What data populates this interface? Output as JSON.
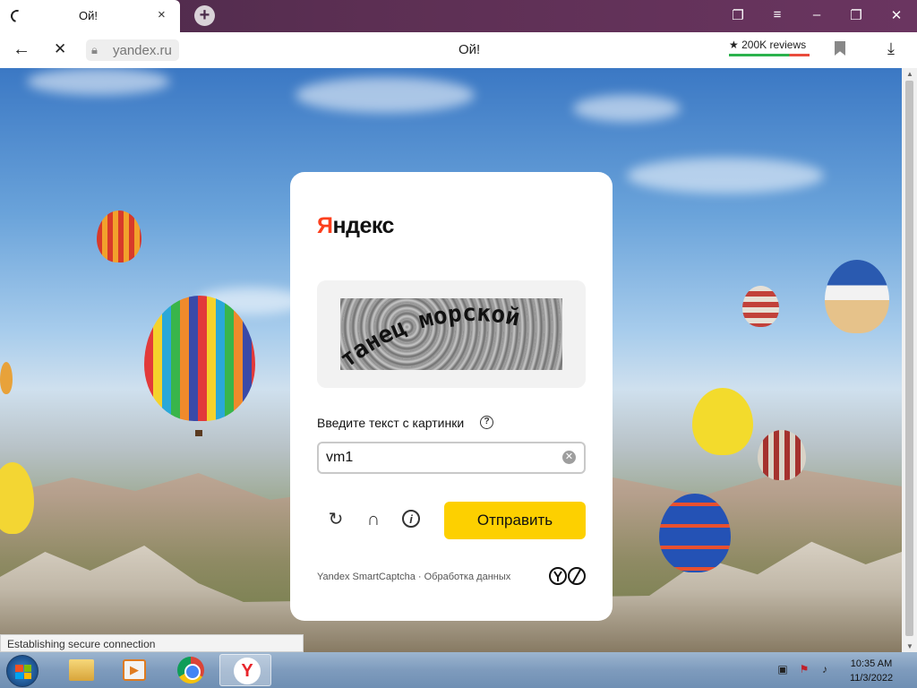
{
  "browser": {
    "tab_title": "Ой!",
    "tab_close": "×",
    "new_tab": "+",
    "url": "yandex.ru",
    "page_title": "Ой!",
    "reviews": "★ 200K reviews",
    "status_text": "Establishing secure connection"
  },
  "captcha": {
    "logo_first": "Я",
    "logo_rest": "ндекс",
    "captcha_words": "танец морской",
    "prompt_label": "Введите текст с картинки",
    "help_symbol": "?",
    "input_value": "vm1",
    "submit_label": "Отправить",
    "footer_text": "Yandex SmartCaptcha · Обработка данных"
  },
  "taskbar": {
    "clock_time": "10:35 AM",
    "clock_date": "11/3/2022"
  },
  "colors": {
    "accent_yellow": "#fdd000",
    "yandex_red": "#fc3f1d",
    "tab_bar": "#5c2f53"
  }
}
